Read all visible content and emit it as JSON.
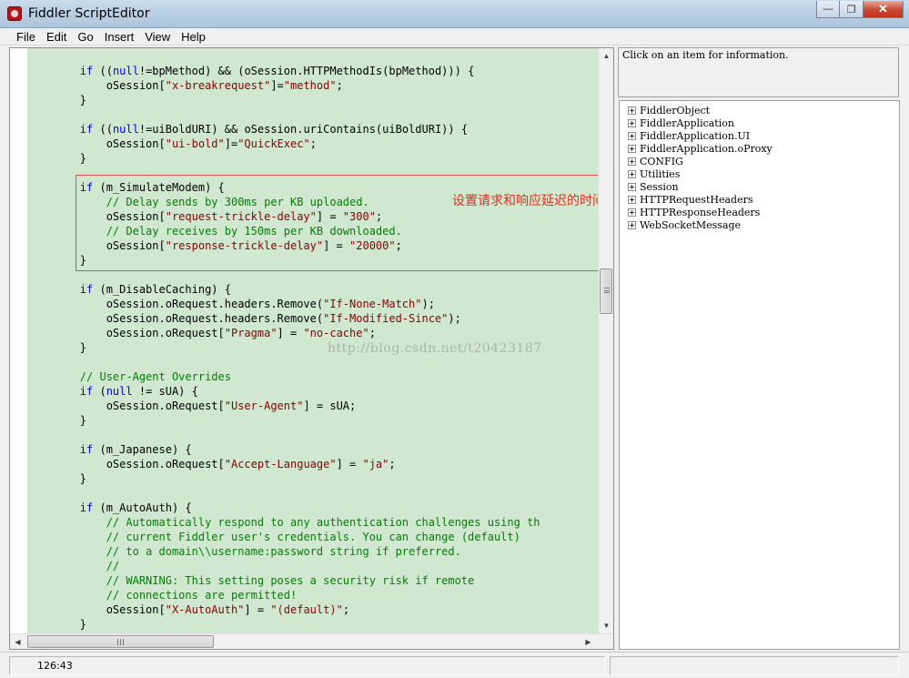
{
  "window": {
    "title": "Fiddler ScriptEditor",
    "minimize_label": "—",
    "restore_label": "❐",
    "close_label": "✕"
  },
  "menu": [
    "File",
    "Edit",
    "Go",
    "Insert",
    "View",
    "Help"
  ],
  "editor": {
    "annotation": "设置请求和响应延迟的时间",
    "watermark": "http://blog.csdn.net/t20423187",
    "lines": [
      [
        [
          "",
          "        "
        ],
        [
          "kw",
          "if"
        ],
        [
          "",
          " (("
        ],
        [
          "kw",
          "null"
        ],
        [
          "",
          "!=bpMethod) && (oSession.HTTPMethodIs(bpMethod))) {"
        ]
      ],
      [
        [
          "",
          "            oSession["
        ],
        [
          "str",
          "\"x-breakrequest\""
        ],
        [
          "",
          "]="
        ],
        [
          "str",
          "\"method\""
        ],
        [
          "",
          ";"
        ]
      ],
      [
        [
          "",
          "        }"
        ]
      ],
      [],
      [
        [
          "",
          "        "
        ],
        [
          "kw",
          "if"
        ],
        [
          "",
          " (("
        ],
        [
          "kw",
          "null"
        ],
        [
          "",
          "!=uiBoldURI) && oSession.uriContains(uiBoldURI)) {"
        ]
      ],
      [
        [
          "",
          "            oSession["
        ],
        [
          "str",
          "\"ui-bold\""
        ],
        [
          "",
          "]="
        ],
        [
          "str",
          "\"QuickExec\""
        ],
        [
          "",
          ";"
        ]
      ],
      [
        [
          "",
          "        }"
        ]
      ],
      [],
      [
        [
          "",
          "        "
        ],
        [
          "kw",
          "if"
        ],
        [
          "",
          " (m_SimulateModem) {"
        ]
      ],
      [
        [
          "",
          "            "
        ],
        [
          "cm",
          "// Delay sends by 300ms per KB uploaded."
        ]
      ],
      [
        [
          "",
          "            oSession["
        ],
        [
          "str",
          "\"request-trickle-delay\""
        ],
        [
          "",
          "] = "
        ],
        [
          "str",
          "\"300\""
        ],
        [
          "",
          ";"
        ]
      ],
      [
        [
          "",
          "            "
        ],
        [
          "cm",
          "// Delay receives by 150ms per KB downloaded."
        ]
      ],
      [
        [
          "",
          "            oSession["
        ],
        [
          "str",
          "\"response-trickle-delay\""
        ],
        [
          "",
          "] = "
        ],
        [
          "str",
          "\"20000\""
        ],
        [
          "",
          ";"
        ]
      ],
      [
        [
          "",
          "        }"
        ]
      ],
      [],
      [
        [
          "",
          "        "
        ],
        [
          "kw",
          "if"
        ],
        [
          "",
          " (m_DisableCaching) {"
        ]
      ],
      [
        [
          "",
          "            oSession.oRequest.headers.Remove("
        ],
        [
          "str",
          "\"If-None-Match\""
        ],
        [
          "",
          ");"
        ]
      ],
      [
        [
          "",
          "            oSession.oRequest.headers.Remove("
        ],
        [
          "str",
          "\"If-Modified-Since\""
        ],
        [
          "",
          ");"
        ]
      ],
      [
        [
          "",
          "            oSession.oRequest["
        ],
        [
          "str",
          "\"Pragma\""
        ],
        [
          "",
          "] = "
        ],
        [
          "str",
          "\"no-cache\""
        ],
        [
          "",
          ";"
        ]
      ],
      [
        [
          "",
          "        }"
        ]
      ],
      [],
      [
        [
          "",
          "        "
        ],
        [
          "cm",
          "// User-Agent Overrides"
        ]
      ],
      [
        [
          "",
          "        "
        ],
        [
          "kw",
          "if"
        ],
        [
          "",
          " ("
        ],
        [
          "kw",
          "null"
        ],
        [
          "",
          " != sUA) {"
        ]
      ],
      [
        [
          "",
          "            oSession.oRequest["
        ],
        [
          "str",
          "\"User-Agent\""
        ],
        [
          "",
          "] = sUA;"
        ]
      ],
      [
        [
          "",
          "        }"
        ]
      ],
      [],
      [
        [
          "",
          "        "
        ],
        [
          "kw",
          "if"
        ],
        [
          "",
          " (m_Japanese) {"
        ]
      ],
      [
        [
          "",
          "            oSession.oRequest["
        ],
        [
          "str",
          "\"Accept-Language\""
        ],
        [
          "",
          "] = "
        ],
        [
          "str",
          "\"ja\""
        ],
        [
          "",
          ";"
        ]
      ],
      [
        [
          "",
          "        }"
        ]
      ],
      [],
      [
        [
          "",
          "        "
        ],
        [
          "kw",
          "if"
        ],
        [
          "",
          " (m_AutoAuth) {"
        ]
      ],
      [
        [
          "",
          "            "
        ],
        [
          "cm",
          "// Automatically respond to any authentication challenges using th"
        ]
      ],
      [
        [
          "",
          "            "
        ],
        [
          "cm",
          "// current Fiddler user's credentials. You can change (default)"
        ]
      ],
      [
        [
          "",
          "            "
        ],
        [
          "cm",
          "// to a domain\\\\username:password string if preferred."
        ]
      ],
      [
        [
          "",
          "            "
        ],
        [
          "cm",
          "//"
        ]
      ],
      [
        [
          "",
          "            "
        ],
        [
          "cm",
          "// WARNING: This setting poses a security risk if remote"
        ]
      ],
      [
        [
          "",
          "            "
        ],
        [
          "cm",
          "// connections are permitted!"
        ]
      ],
      [
        [
          "",
          "            oSession["
        ],
        [
          "str",
          "\"X-AutoAuth\""
        ],
        [
          "",
          "] = "
        ],
        [
          "str",
          "\"(default)\""
        ],
        [
          "",
          ";"
        ]
      ],
      [
        [
          "",
          "        }"
        ]
      ]
    ]
  },
  "info_pane": {
    "text": "Click on an item for information."
  },
  "tree": [
    "FiddlerObject",
    "FiddlerApplication",
    "FiddlerApplication.UI",
    "FiddlerApplication.oProxy",
    "CONFIG",
    "Utilities",
    "Session",
    "HTTPRequestHeaders",
    "HTTPResponseHeaders",
    "WebSocketMessage"
  ],
  "status": {
    "position": "126:43"
  },
  "icons": {
    "app": "fiddler-app-icon",
    "scroll_up": "▲",
    "scroll_down": "▼",
    "scroll_left": "◀",
    "scroll_right": "▶"
  }
}
